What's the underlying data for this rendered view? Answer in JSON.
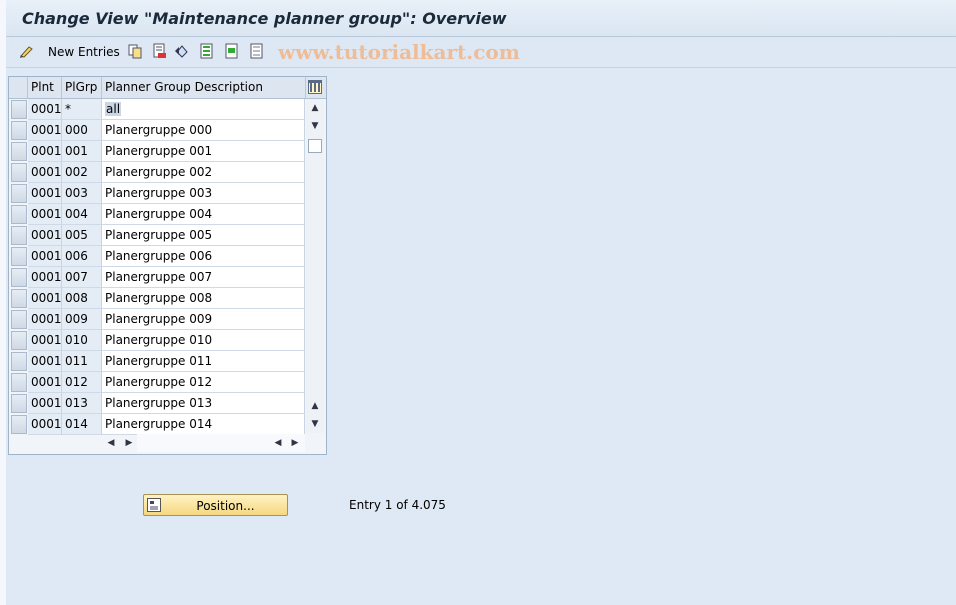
{
  "window": {
    "title": "Change View \"Maintenance planner group\": Overview"
  },
  "toolbar": {
    "new_entries_label": "New Entries",
    "icons": [
      "edit-glasses-icon",
      "copy-icon",
      "delete-icon",
      "undo-icon",
      "select-all-icon",
      "select-block-icon",
      "deselect-all-icon"
    ],
    "watermark": "www.tutorialkart.com"
  },
  "table": {
    "columns": [
      "Plnt",
      "PlGrp",
      "Planner Group Description"
    ],
    "rows": [
      {
        "plnt": "0001",
        "plgrp": "*",
        "desc": "all"
      },
      {
        "plnt": "0001",
        "plgrp": "000",
        "desc": "Planergruppe 000"
      },
      {
        "plnt": "0001",
        "plgrp": "001",
        "desc": "Planergruppe 001"
      },
      {
        "plnt": "0001",
        "plgrp": "002",
        "desc": "Planergruppe 002"
      },
      {
        "plnt": "0001",
        "plgrp": "003",
        "desc": "Planergruppe 003"
      },
      {
        "plnt": "0001",
        "plgrp": "004",
        "desc": "Planergruppe 004"
      },
      {
        "plnt": "0001",
        "plgrp": "005",
        "desc": "Planergruppe 005"
      },
      {
        "plnt": "0001",
        "plgrp": "006",
        "desc": "Planergruppe 006"
      },
      {
        "plnt": "0001",
        "plgrp": "007",
        "desc": "Planergruppe 007"
      },
      {
        "plnt": "0001",
        "plgrp": "008",
        "desc": "Planergruppe 008"
      },
      {
        "plnt": "0001",
        "plgrp": "009",
        "desc": "Planergruppe 009"
      },
      {
        "plnt": "0001",
        "plgrp": "010",
        "desc": "Planergruppe 010"
      },
      {
        "plnt": "0001",
        "plgrp": "011",
        "desc": "Planergruppe 011"
      },
      {
        "plnt": "0001",
        "plgrp": "012",
        "desc": "Planergruppe 012"
      },
      {
        "plnt": "0001",
        "plgrp": "013",
        "desc": "Planergruppe 013"
      },
      {
        "plnt": "0001",
        "plgrp": "014",
        "desc": "Planergruppe 014"
      }
    ]
  },
  "footer": {
    "position_button_label": "Position...",
    "entry_info": "Entry 1 of 4.075"
  }
}
